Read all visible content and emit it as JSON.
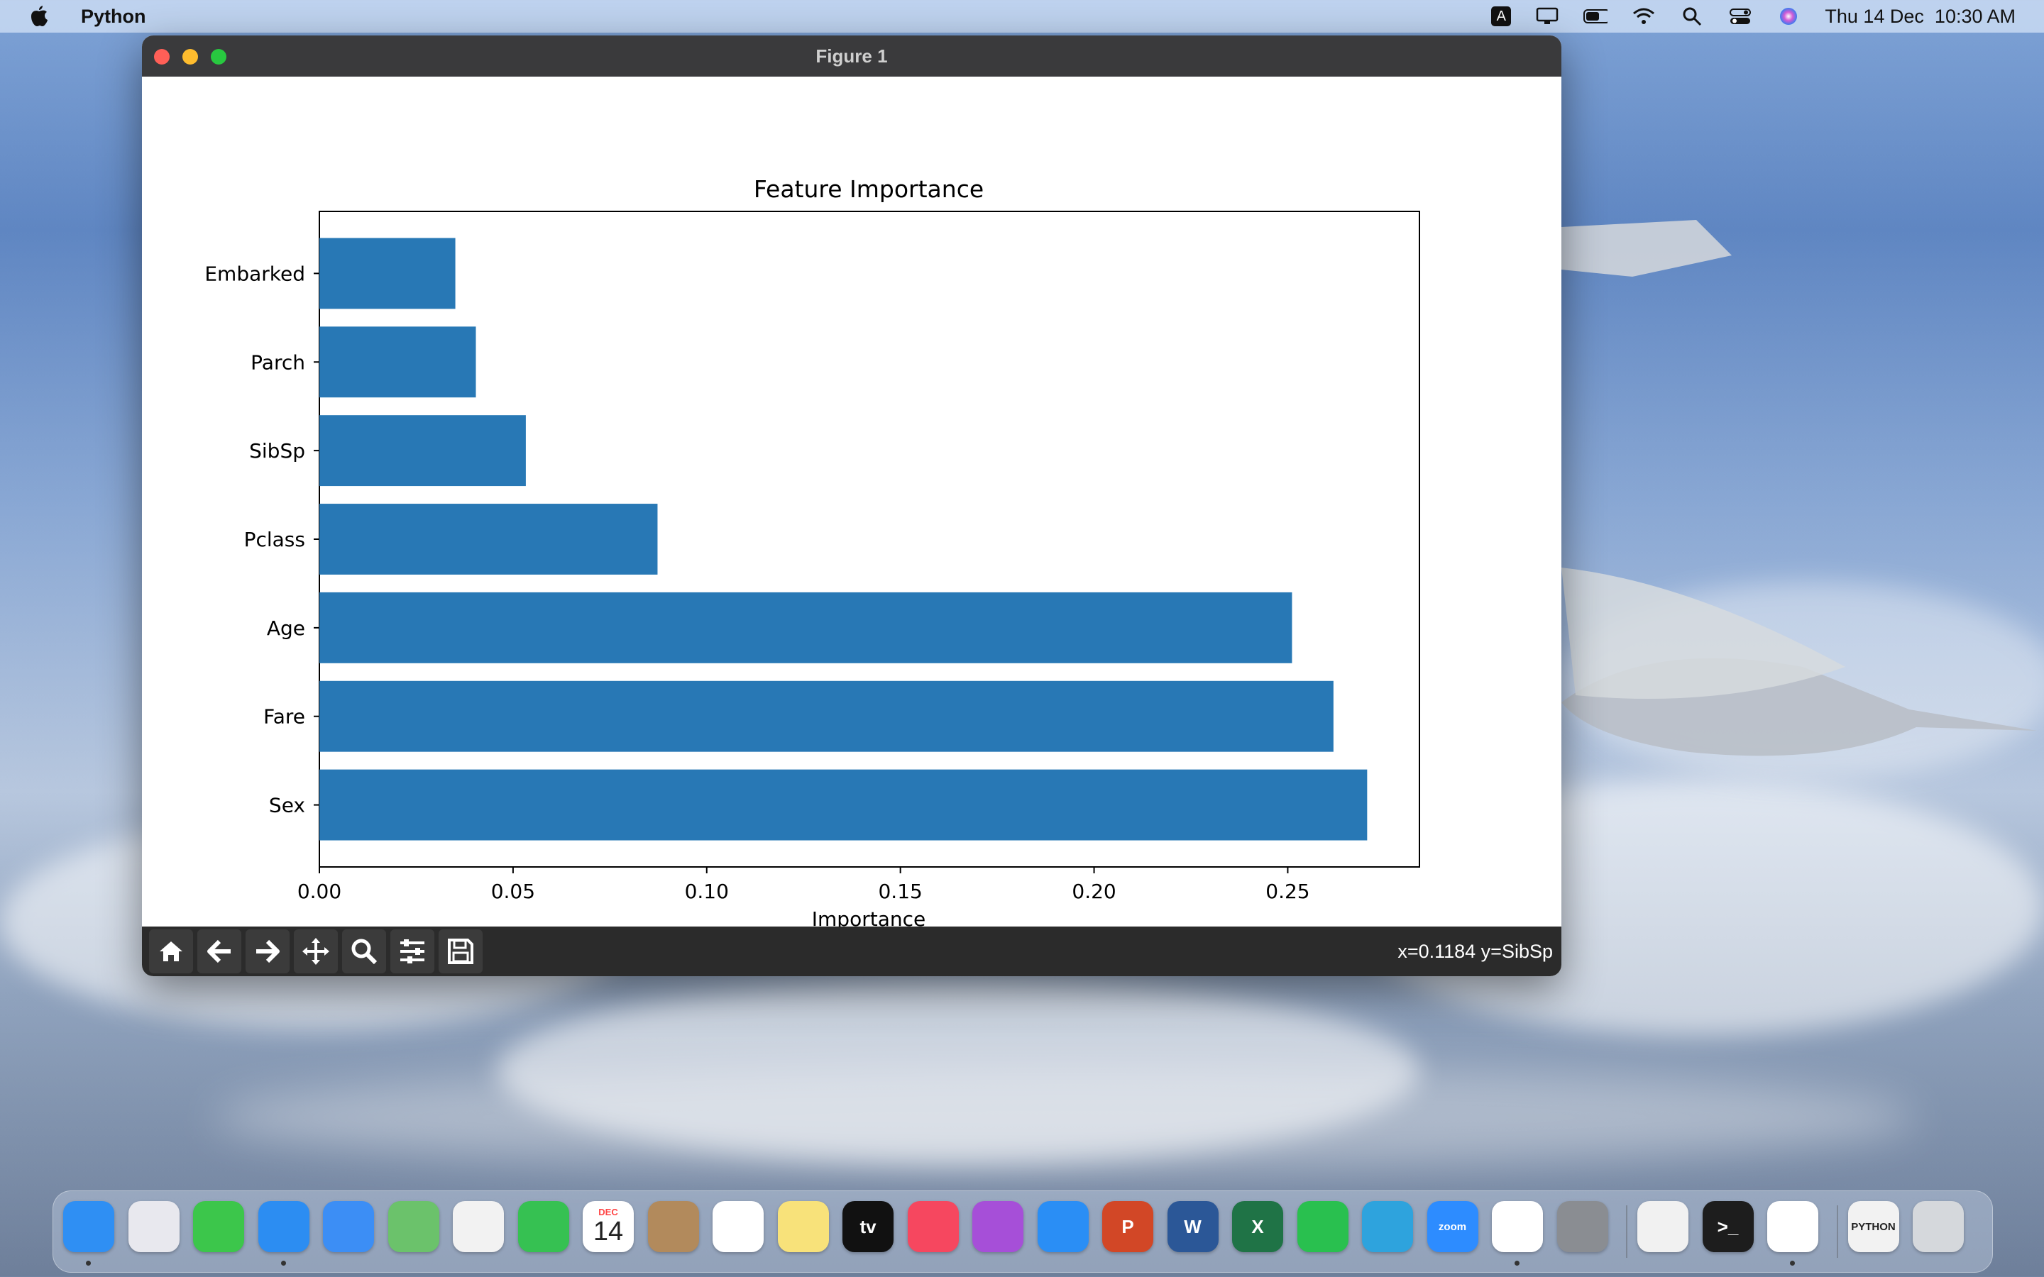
{
  "menubar": {
    "app_name": "Python",
    "datetime": "Thu 14 Dec  10:30 AM",
    "input_badge": "A",
    "icons": [
      "apple-icon",
      "input-source-icon",
      "display-icon",
      "battery-icon",
      "wifi-icon",
      "spotlight-icon",
      "control-center-icon",
      "siri-icon"
    ]
  },
  "window": {
    "title": "Figure 1",
    "status_text": "x=0.1184 y=SibSp",
    "toolbar_icons": [
      "home-icon",
      "back-arrow-icon",
      "forward-arrow-icon",
      "pan-icon",
      "zoom-icon",
      "configure-subplots-icon",
      "save-icon"
    ]
  },
  "chart_data": {
    "type": "bar",
    "orientation": "horizontal",
    "title": "Feature Importance",
    "xlabel": "Importance",
    "ylabel": "",
    "categories": [
      "Sex",
      "Fare",
      "Age",
      "Pclass",
      "SibSp",
      "Parch",
      "Embarked"
    ],
    "values": [
      0.2705,
      0.2618,
      0.2511,
      0.0873,
      0.0533,
      0.0404,
      0.0351
    ],
    "xlim": [
      0,
      0.284
    ],
    "xticks": [
      "0.00",
      "0.05",
      "0.10",
      "0.15",
      "0.20",
      "0.25"
    ],
    "bar_color": "#2878b5",
    "grid": false
  },
  "dock": {
    "apps": [
      {
        "name": "Finder",
        "label": "",
        "color": "#2f8ff3",
        "running": true
      },
      {
        "name": "Launchpad",
        "label": "",
        "color": "#e8e8ee",
        "running": false
      },
      {
        "name": "Messages",
        "label": "",
        "color": "#3cc64b",
        "running": false
      },
      {
        "name": "Safari",
        "label": "",
        "color": "#2c8df2",
        "running": true
      },
      {
        "name": "Mail",
        "label": "",
        "color": "#3c8ef5",
        "running": false
      },
      {
        "name": "Maps",
        "label": "",
        "color": "#6bc26b",
        "running": false
      },
      {
        "name": "Photos",
        "label": "",
        "color": "#f2f2f2",
        "running": false
      },
      {
        "name": "FaceTime",
        "label": "",
        "color": "#36c152",
        "running": false
      },
      {
        "name": "Calendar",
        "label": "14",
        "color": "#ffffff",
        "running": false
      },
      {
        "name": "Contacts",
        "label": "",
        "color": "#b28a5c",
        "running": false
      },
      {
        "name": "Reminders",
        "label": "",
        "color": "#ffffff",
        "running": false
      },
      {
        "name": "Notes",
        "label": "",
        "color": "#f8e27a",
        "running": false
      },
      {
        "name": "TV",
        "label": "tv",
        "color": "#111111",
        "running": false
      },
      {
        "name": "Music",
        "label": "",
        "color": "#f6475f",
        "running": false
      },
      {
        "name": "Podcasts",
        "label": "",
        "color": "#a64fd8",
        "running": false
      },
      {
        "name": "App Store",
        "label": "",
        "color": "#2a8ef5",
        "running": false
      },
      {
        "name": "PowerPoint",
        "label": "P",
        "color": "#d24726",
        "running": false
      },
      {
        "name": "Word",
        "label": "W",
        "color": "#2b5797",
        "running": false
      },
      {
        "name": "Excel",
        "label": "X",
        "color": "#1f7346",
        "running": false
      },
      {
        "name": "WhatsApp",
        "label": "",
        "color": "#29c04f",
        "running": false
      },
      {
        "name": "Telegram",
        "label": "",
        "color": "#2ea3dd",
        "running": false
      },
      {
        "name": "Zoom",
        "label": "zoom",
        "color": "#2d8cff",
        "running": false
      },
      {
        "name": "VS Code",
        "label": "",
        "color": "#ffffff",
        "running": true
      },
      {
        "name": "System Settings",
        "label": "",
        "color": "#8a8d92",
        "running": false
      },
      {
        "name": "Python Launcher",
        "label": "",
        "color": "#f1f1f1",
        "running": false
      },
      {
        "name": "Terminal",
        "label": ">_",
        "color": "#1d1d1d",
        "running": false
      },
      {
        "name": "Python Figure",
        "label": "",
        "color": "#ffffff",
        "running": true
      },
      {
        "name": "Python Document",
        "label": "PYTHON",
        "color": "#f2f2f2",
        "running": false
      },
      {
        "name": "Trash",
        "label": "",
        "color": "#d5d8dc",
        "running": false
      }
    ]
  },
  "dock_calendar_month": "DEC"
}
